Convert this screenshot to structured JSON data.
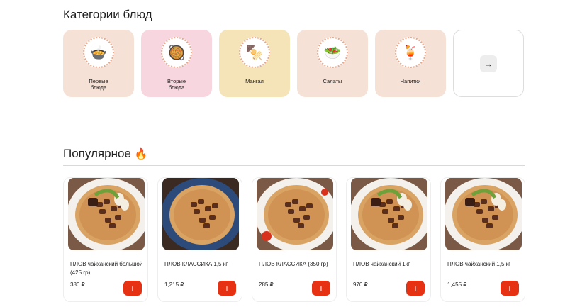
{
  "categories_section": {
    "title": "Категории блюд"
  },
  "categories": [
    {
      "label": "Первые\nблюда",
      "color": "#f6e1d6",
      "icon": "soup-icon",
      "glyph": "🍲"
    },
    {
      "label": "Вторые\nблюда",
      "color": "#f8d6df",
      "icon": "main-dish-icon",
      "glyph": "🥘"
    },
    {
      "label": "Мангал",
      "color": "#f6e4b9",
      "icon": "skewer-icon",
      "glyph": "🍢"
    },
    {
      "label": "Салаты",
      "color": "#f6e1d6",
      "icon": "salad-icon",
      "glyph": "🥗"
    },
    {
      "label": "Напитки",
      "color": "#f6e1d6",
      "icon": "drink-icon",
      "glyph": "🍹"
    }
  ],
  "more_button": {
    "icon": "arrow-right-icon",
    "glyph": "→"
  },
  "popular_section": {
    "title": "Популярное",
    "icon": "fire-icon",
    "glyph": "🔥"
  },
  "products": [
    {
      "name": "ПЛОВ чайханский большой (425 гр)",
      "price": "380 ₽",
      "add": "+",
      "variant": "chaikhana"
    },
    {
      "name": "ПЛОВ КЛАССИКА 1,5 кг",
      "price": "1,215 ₽",
      "add": "+",
      "variant": "classic-dark"
    },
    {
      "name": "ПЛОВ КЛАССИКА (350 гр)",
      "price": "285 ₽",
      "add": "+",
      "variant": "classic-light"
    },
    {
      "name": "ПЛОВ чайханский 1кг.",
      "price": "970 ₽",
      "add": "+",
      "variant": "chaikhana"
    },
    {
      "name": "ПЛОВ чайханский 1,5 кг",
      "price": "1,455 ₽",
      "add": "+",
      "variant": "chaikhana"
    }
  ]
}
